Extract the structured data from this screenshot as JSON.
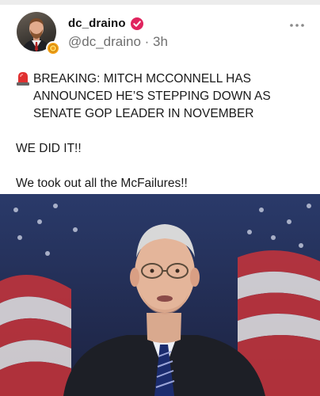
{
  "post": {
    "display_name": "dc_draino",
    "handle": "@dc_draino",
    "separator": " · ",
    "time": "3h",
    "text": {
      "line1": "BREAKING: MITCH MCCONNELL HAS ANNOUNCED HE’S STEPPING DOWN AS SENATE GOP LEADER IN NOVEMBER",
      "line2": "WE DID IT!!",
      "line3": "We took out all the McFailures!!"
    },
    "icons": {
      "avatar": "avatar",
      "verified": "verified-badge-icon",
      "avatar_badge": "award-badge-icon",
      "more": "more-dots-icon",
      "siren": "siren-emoji-icon"
    }
  },
  "colors": {
    "verified": "#e0245e",
    "handle": "#6f6f6f",
    "badge": "#f2a019"
  }
}
